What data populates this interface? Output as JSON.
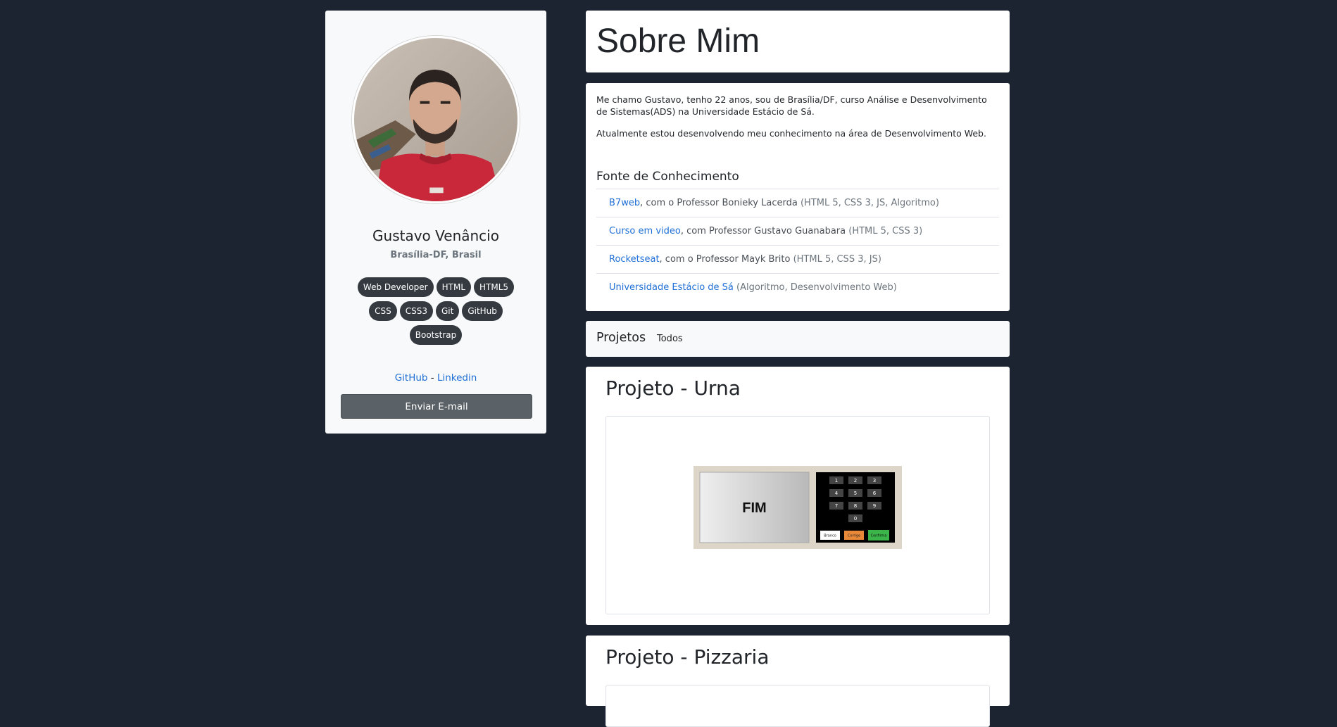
{
  "profile": {
    "name": "Gustavo Venâncio",
    "location": "Brasília-DF, Brasil",
    "tags": [
      "Web Developer",
      "HTML",
      "HTML5",
      "CSS",
      "CSS3",
      "Git",
      "GitHub",
      "Bootstrap"
    ],
    "links": {
      "github": "GitHub",
      "separator": "-",
      "linkedin": "Linkedin"
    },
    "email_button": "Enviar E-mail"
  },
  "about": {
    "title": "Sobre Mim",
    "paragraph1": "Me chamo Gustavo, tenho 22 anos, sou de Brasília/DF, curso Análise e Desenvolvimento de Sistemas(ADS) na Universidade Estácio de Sá.",
    "paragraph2": "Atualmente estou desenvolvendo meu conhecimento na área de Desenvolvimento Web.",
    "knowledge_title": "Fonte de Conhecimento",
    "knowledge": [
      {
        "link": "B7web",
        "text": ", com o Professor Bonieky Lacerda",
        "topics": " (HTML 5, CSS 3, JS, Algoritmo)"
      },
      {
        "link": "Curso em video",
        "text": ", com Professor Gustavo Guanabara",
        "topics": " (HTML 5, CSS 3)"
      },
      {
        "link": "Rocketseat",
        "text": ", com o Professor Mayk Brito",
        "topics": " (HTML 5, CSS 3, JS)"
      },
      {
        "link": "Universidade Estácio de Sá",
        "text": "",
        "topics": " (Algoritmo, Desenvolvimento Web)"
      }
    ]
  },
  "projects_nav": {
    "brand": "Projetos",
    "all": "Todos"
  },
  "projects": [
    {
      "title": "Projeto - Urna",
      "preview": {
        "screen_text": "FIM",
        "keys": [
          "1",
          "2",
          "3",
          "4",
          "5",
          "6",
          "7",
          "8",
          "9",
          "0"
        ],
        "branco": "Branco",
        "corrige": "Corrige",
        "confirma": "Confirma"
      }
    },
    {
      "title": "Projeto - Pizzaria"
    }
  ]
}
